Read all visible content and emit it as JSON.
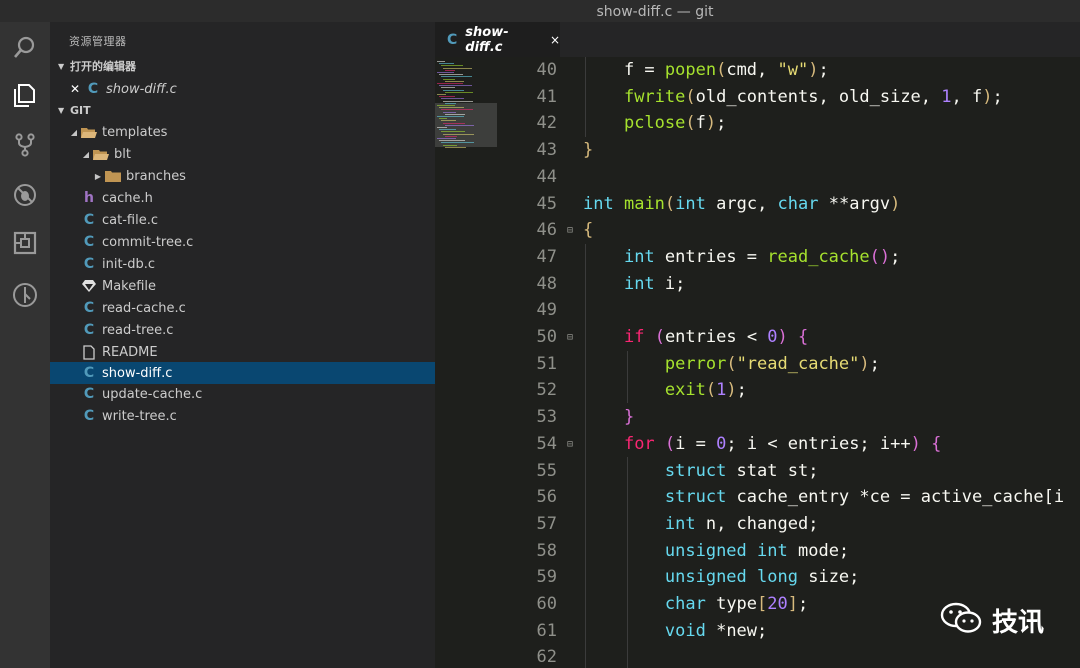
{
  "window": {
    "title": "show-diff.c — git"
  },
  "activity_bar": {
    "items": [
      {
        "icon": "search-icon"
      },
      {
        "icon": "files-icon"
      },
      {
        "icon": "source-control-icon"
      },
      {
        "icon": "debug-icon"
      },
      {
        "icon": "extensions-icon"
      },
      {
        "icon": "git-graph-icon"
      }
    ]
  },
  "sidebar": {
    "title": "资源管理器",
    "open_editors": {
      "label": "打开的编辑器",
      "items": [
        {
          "name": "show-diff.c"
        }
      ]
    },
    "folder": {
      "label": "GIT",
      "tree": [
        {
          "name": "templates"
        },
        {
          "name": "blt"
        },
        {
          "name": "branches"
        },
        {
          "name": "cache.h"
        },
        {
          "name": "cat-file.c"
        },
        {
          "name": "commit-tree.c"
        },
        {
          "name": "init-db.c"
        },
        {
          "name": "Makefile"
        },
        {
          "name": "read-cache.c"
        },
        {
          "name": "read-tree.c"
        },
        {
          "name": "README"
        },
        {
          "name": "show-diff.c"
        },
        {
          "name": "update-cache.c"
        },
        {
          "name": "write-tree.c"
        }
      ]
    }
  },
  "editor": {
    "tab": {
      "label": "show-diff.c",
      "close": "×"
    },
    "line_numbers": [
      "40",
      "41",
      "42",
      "43",
      "44",
      "45",
      "46",
      "47",
      "48",
      "49",
      "50",
      "51",
      "52",
      "53",
      "54",
      "55",
      "56",
      "57",
      "58",
      "59",
      "60",
      "61",
      "62"
    ],
    "fold_markers": [
      "⊟",
      "⊟",
      "⊟"
    ]
  },
  "code_lines": [
    [
      [
        "vd",
        "    f = "
      ],
      [
        "fn",
        "popen"
      ],
      [
        "br",
        "("
      ],
      [
        "vd",
        "cmd, "
      ],
      [
        "str",
        "\"w\""
      ],
      [
        "br",
        ")"
      ],
      [
        "vd",
        ";"
      ]
    ],
    [
      [
        "vd",
        "    "
      ],
      [
        "fn",
        "fwrite"
      ],
      [
        "br",
        "("
      ],
      [
        "vd",
        "old_contents, old_size, "
      ],
      [
        "num",
        "1"
      ],
      [
        "vd",
        ", f"
      ],
      [
        "br",
        ")"
      ],
      [
        "vd",
        ";"
      ]
    ],
    [
      [
        "vd",
        "    "
      ],
      [
        "fn",
        "pclose"
      ],
      [
        "br",
        "("
      ],
      [
        "vd",
        "f"
      ],
      [
        "br",
        ")"
      ],
      [
        "vd",
        ";"
      ]
    ],
    [
      [
        "br",
        "}"
      ]
    ],
    [
      [
        "vd",
        ""
      ]
    ],
    [
      [
        "ty",
        "int"
      ],
      [
        "vd",
        " "
      ],
      [
        "fn",
        "main"
      ],
      [
        "br",
        "("
      ],
      [
        "ty",
        "int"
      ],
      [
        "vd",
        " argc, "
      ],
      [
        "ty",
        "char"
      ],
      [
        "vd",
        " **argv"
      ],
      [
        "br",
        ")"
      ]
    ],
    [
      [
        "br",
        "{"
      ]
    ],
    [
      [
        "vd",
        "    "
      ],
      [
        "ty",
        "int"
      ],
      [
        "vd",
        " entries = "
      ],
      [
        "fn",
        "read_cache"
      ],
      [
        "br2",
        "()"
      ],
      [
        "vd",
        ";"
      ]
    ],
    [
      [
        "vd",
        "    "
      ],
      [
        "ty",
        "int"
      ],
      [
        "vd",
        " i;"
      ]
    ],
    [
      [
        "vd",
        ""
      ]
    ],
    [
      [
        "vd",
        "    "
      ],
      [
        "ctl",
        "if"
      ],
      [
        "vd",
        " "
      ],
      [
        "br2",
        "("
      ],
      [
        "vd",
        "entries < "
      ],
      [
        "num",
        "0"
      ],
      [
        "br2",
        ")"
      ],
      [
        "vd",
        " "
      ],
      [
        "br2",
        "{"
      ]
    ],
    [
      [
        "vd",
        "        "
      ],
      [
        "fn",
        "perror"
      ],
      [
        "br",
        "("
      ],
      [
        "str",
        "\"read_cache\""
      ],
      [
        "br",
        ")"
      ],
      [
        "vd",
        ";"
      ]
    ],
    [
      [
        "vd",
        "        "
      ],
      [
        "fn",
        "exit"
      ],
      [
        "br",
        "("
      ],
      [
        "num",
        "1"
      ],
      [
        "br",
        ")"
      ],
      [
        "vd",
        ";"
      ]
    ],
    [
      [
        "vd",
        "    "
      ],
      [
        "br2",
        "}"
      ]
    ],
    [
      [
        "vd",
        "    "
      ],
      [
        "ctl",
        "for"
      ],
      [
        "vd",
        " "
      ],
      [
        "br2",
        "("
      ],
      [
        "vd",
        "i = "
      ],
      [
        "num",
        "0"
      ],
      [
        "vd",
        "; i < entries; i++"
      ],
      [
        "br2",
        ")"
      ],
      [
        "vd",
        " "
      ],
      [
        "br2",
        "{"
      ]
    ],
    [
      [
        "vd",
        "        "
      ],
      [
        "kw",
        "struct"
      ],
      [
        "vd",
        " stat st;"
      ]
    ],
    [
      [
        "vd",
        "        "
      ],
      [
        "kw",
        "struct"
      ],
      [
        "vd",
        " cache_entry *ce = active_cache[i"
      ]
    ],
    [
      [
        "vd",
        "        "
      ],
      [
        "ty",
        "int"
      ],
      [
        "vd",
        " n, changed;"
      ]
    ],
    [
      [
        "vd",
        "        "
      ],
      [
        "kw",
        "unsigned"
      ],
      [
        "vd",
        " "
      ],
      [
        "ty",
        "int"
      ],
      [
        "vd",
        " mode;"
      ]
    ],
    [
      [
        "vd",
        "        "
      ],
      [
        "kw",
        "unsigned"
      ],
      [
        "vd",
        " "
      ],
      [
        "ty",
        "long"
      ],
      [
        "vd",
        " size;"
      ]
    ],
    [
      [
        "vd",
        "        "
      ],
      [
        "ty",
        "char"
      ],
      [
        "vd",
        " type"
      ],
      [
        "br",
        "["
      ],
      [
        "num",
        "20"
      ],
      [
        "br",
        "]"
      ],
      [
        "vd",
        ";"
      ]
    ],
    [
      [
        "vd",
        "        "
      ],
      [
        "ty",
        "void"
      ],
      [
        "vd",
        " *new;"
      ]
    ],
    [
      [
        "vd",
        ""
      ]
    ]
  ],
  "watermark": {
    "text": "技讯"
  }
}
